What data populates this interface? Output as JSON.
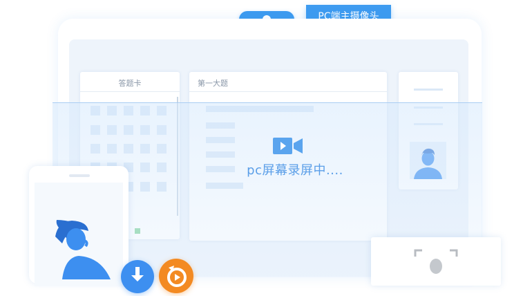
{
  "top_controls": {
    "camera_label": "PC端主摄像头"
  },
  "answer_card": {
    "title": "答题卡"
  },
  "question_panel": {
    "title": "第一大题"
  },
  "recording": {
    "status_text": "pc屏幕录屏中...."
  },
  "colors": {
    "accent": "#3d9bf0",
    "orange": "#f38a22",
    "green": "#8dd7a6"
  },
  "icons": [
    "video-camera-icon",
    "user-avatar-icon",
    "download-icon",
    "replay-icon",
    "face-scan-icon"
  ]
}
